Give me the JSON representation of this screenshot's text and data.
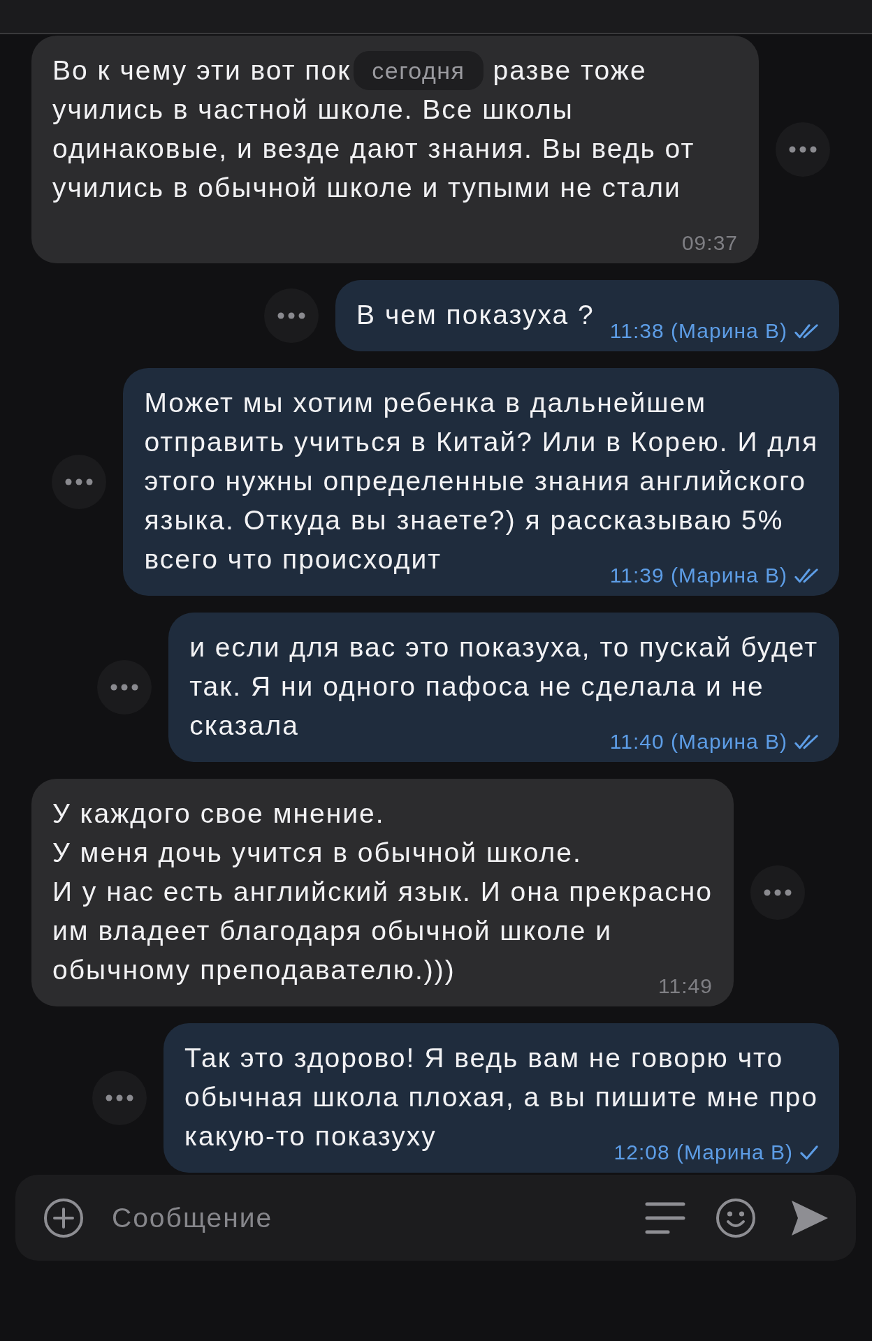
{
  "messages": [
    {
      "kind": "incoming",
      "text_before_date": "Во к чему эти вот пок",
      "date": "сегодня",
      "text_after_date": "разве тоже",
      "text": "учились в частной школе. Все школы\nодинаковые, и везде дают знания. Вы ведь от\nучились в обычной школе и тупыми не стали",
      "time": "09:37"
    },
    {
      "kind": "outgoing",
      "text": "В чем показуха ?",
      "time": "11:38 (Марина В)",
      "read": true
    },
    {
      "kind": "outgoing",
      "text": "Может мы хотим ребенка в дальнейшем\nотправить учиться в Китай? Или в Корею. И для\nэтого нужны определенные знания английского\nязыка. Откуда вы знаете?) я рассказываю 5%\nвсего что происходит",
      "time": "11:39 (Марина В)",
      "read": true
    },
    {
      "kind": "outgoing",
      "text": "и если для вас это показуха, то пускай будет\nтак. Я ни одного пафоса не сделала и не\nсказала",
      "time": "11:40 (Марина В)",
      "read": true
    },
    {
      "kind": "incoming",
      "text": "У каждого свое мнение.\nУ меня дочь учится в обычной школе.\nИ у нас есть английский язык. И она прекрасно\nим владеет благодаря обычной школе и\nобычному преподавателю.)))",
      "time": "11:49"
    },
    {
      "kind": "outgoing",
      "text": "Так это здорово! Я ведь вам не говорю что\nобычная школа плохая, а вы пишите мне про\nкакую-то показуху",
      "time": "12:08 (Марина В)",
      "read": false
    }
  ],
  "composer": {
    "placeholder": "Сообщение"
  }
}
